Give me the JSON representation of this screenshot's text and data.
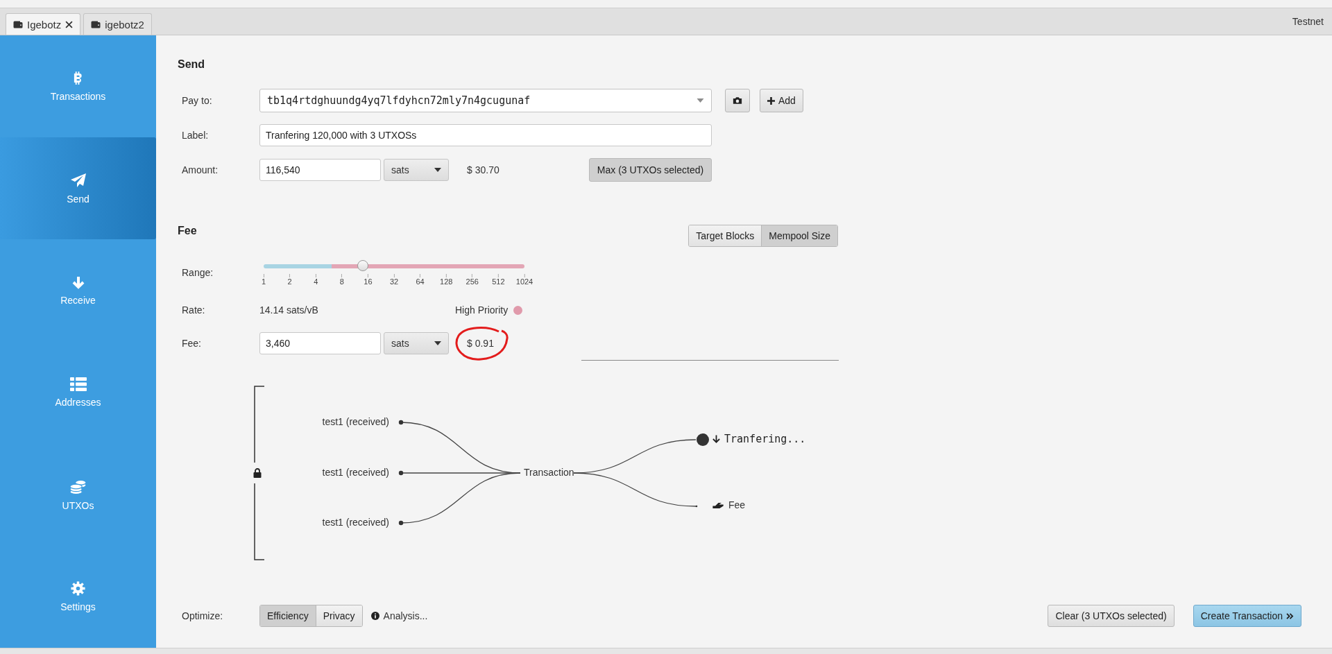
{
  "tabs": [
    {
      "label": "Igebotz",
      "closable": true,
      "selected": true
    },
    {
      "label": "igebotz2",
      "closable": false,
      "selected": false
    }
  ],
  "network": "Testnet",
  "sidebar": {
    "items": [
      {
        "kind": "bitcoin",
        "label": "Transactions",
        "selected": false
      },
      {
        "kind": "send",
        "label": "Send",
        "selected": true
      },
      {
        "kind": "receive",
        "label": "Receive",
        "selected": false
      },
      {
        "kind": "addresses",
        "label": "Addresses",
        "selected": false
      },
      {
        "kind": "utxos",
        "label": "UTXOs",
        "selected": false
      },
      {
        "kind": "settings",
        "label": "Settings",
        "selected": false
      }
    ]
  },
  "send": {
    "title": "Send",
    "pay_to": {
      "label": "Pay to:",
      "value": "tb1q4rtdghuundg4yq7lfdyhcn72mly7n4gcugunaf"
    },
    "label_field": {
      "label": "Label:",
      "value": "Tranfering 120,000 with 3 UTXOSs"
    },
    "amount": {
      "label": "Amount:",
      "value": "116,540",
      "unit": "sats",
      "fiat": "$ 30.70"
    },
    "max_button": "Max (3 UTXOs selected)",
    "add_button": "Add"
  },
  "fee": {
    "title": "Fee",
    "modes": [
      {
        "label": "Target Blocks",
        "selected": false
      },
      {
        "label": "Mempool Size",
        "selected": true
      }
    ],
    "range": {
      "label": "Range:",
      "level": 0.38,
      "ticks": [
        "1",
        "2",
        "4",
        "8",
        "16",
        "32",
        "64",
        "128",
        "256",
        "512",
        "1024"
      ]
    },
    "rate": {
      "label": "Rate:",
      "value": "14.14 sats/vB"
    },
    "priority": "High Priority",
    "fee_field": {
      "label": "Fee:",
      "value": "3,460",
      "unit": "sats",
      "fiat": "$ 0.91",
      "circled": true
    }
  },
  "diagram": {
    "inputs": [
      "test1 (received)",
      "test1 (received)",
      "test1 (received)"
    ],
    "center": "Transaction",
    "outputs": [
      {
        "kind": "payment",
        "label": "Tranfering..."
      },
      {
        "kind": "fee",
        "label": "Fee"
      }
    ]
  },
  "optimize": {
    "label": "Optimize:",
    "options": [
      {
        "label": "Efficiency",
        "selected": true
      },
      {
        "label": "Privacy",
        "selected": false
      }
    ],
    "analysis": "Analysis..."
  },
  "actions": [
    {
      "kind": "secondary",
      "label": "Clear (3 UTXOs selected)"
    },
    {
      "kind": "primary",
      "label": "Create Transaction"
    }
  ]
}
